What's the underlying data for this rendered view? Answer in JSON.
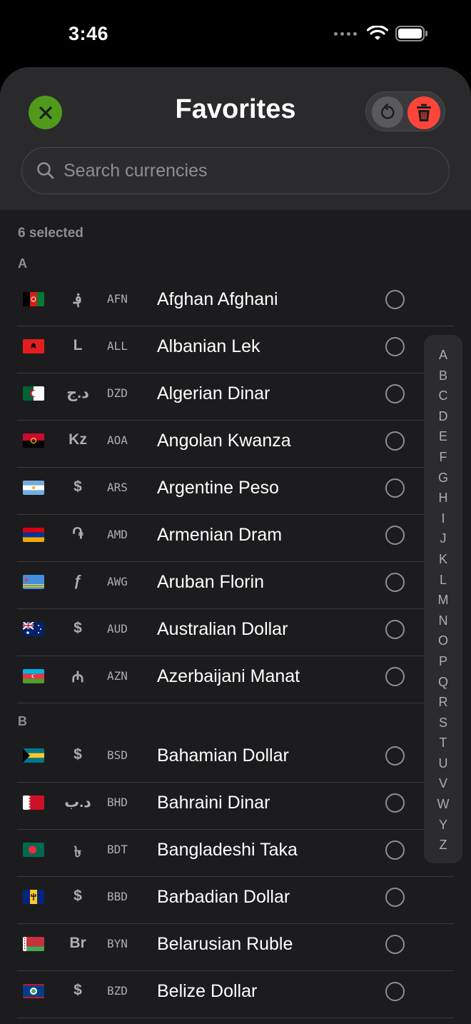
{
  "status_bar": {
    "time": "3:46"
  },
  "header": {
    "title": "Favorites",
    "search_placeholder": "Search currencies"
  },
  "selected_count": "6 selected",
  "sections": [
    {
      "letter": "A",
      "rows": [
        {
          "flag": "af",
          "symbol": "؋",
          "code": "AFN",
          "name": "Afghan Afghani"
        },
        {
          "flag": "al",
          "symbol": "L",
          "code": "ALL",
          "name": "Albanian Lek"
        },
        {
          "flag": "dz",
          "symbol": "د.ج",
          "code": "DZD",
          "name": "Algerian Dinar"
        },
        {
          "flag": "ao",
          "symbol": "Kz",
          "code": "AOA",
          "name": "Angolan Kwanza"
        },
        {
          "flag": "ar",
          "symbol": "$",
          "code": "ARS",
          "name": "Argentine Peso"
        },
        {
          "flag": "am",
          "symbol": "֏",
          "code": "AMD",
          "name": "Armenian Dram"
        },
        {
          "flag": "aw",
          "symbol": "ƒ",
          "code": "AWG",
          "name": "Aruban Florin"
        },
        {
          "flag": "au",
          "symbol": "$",
          "code": "AUD",
          "name": "Australian Dollar"
        },
        {
          "flag": "az",
          "symbol": "₼",
          "code": "AZN",
          "name": "Azerbaijani Manat"
        }
      ]
    },
    {
      "letter": "B",
      "rows": [
        {
          "flag": "bs",
          "symbol": "$",
          "code": "BSD",
          "name": "Bahamian Dollar"
        },
        {
          "flag": "bh",
          "symbol": "د.ب",
          "code": "BHD",
          "name": "Bahraini Dinar"
        },
        {
          "flag": "bd",
          "symbol": "৳",
          "code": "BDT",
          "name": "Bangladeshi Taka"
        },
        {
          "flag": "bb",
          "symbol": "$",
          "code": "BBD",
          "name": "Barbadian Dollar"
        },
        {
          "flag": "by",
          "symbol": "Br",
          "code": "BYN",
          "name": "Belarusian Ruble"
        },
        {
          "flag": "bz",
          "symbol": "$",
          "code": "BZD",
          "name": "Belize Dollar"
        }
      ]
    }
  ],
  "index_letters": [
    "A",
    "B",
    "C",
    "D",
    "E",
    "F",
    "G",
    "H",
    "I",
    "J",
    "K",
    "L",
    "M",
    "N",
    "O",
    "P",
    "Q",
    "R",
    "S",
    "T",
    "U",
    "V",
    "W",
    "Y",
    "Z"
  ],
  "colors": {
    "close_button": "#4f9a1a",
    "delete_button": "#ff453a",
    "background": "#1c1c1e"
  }
}
